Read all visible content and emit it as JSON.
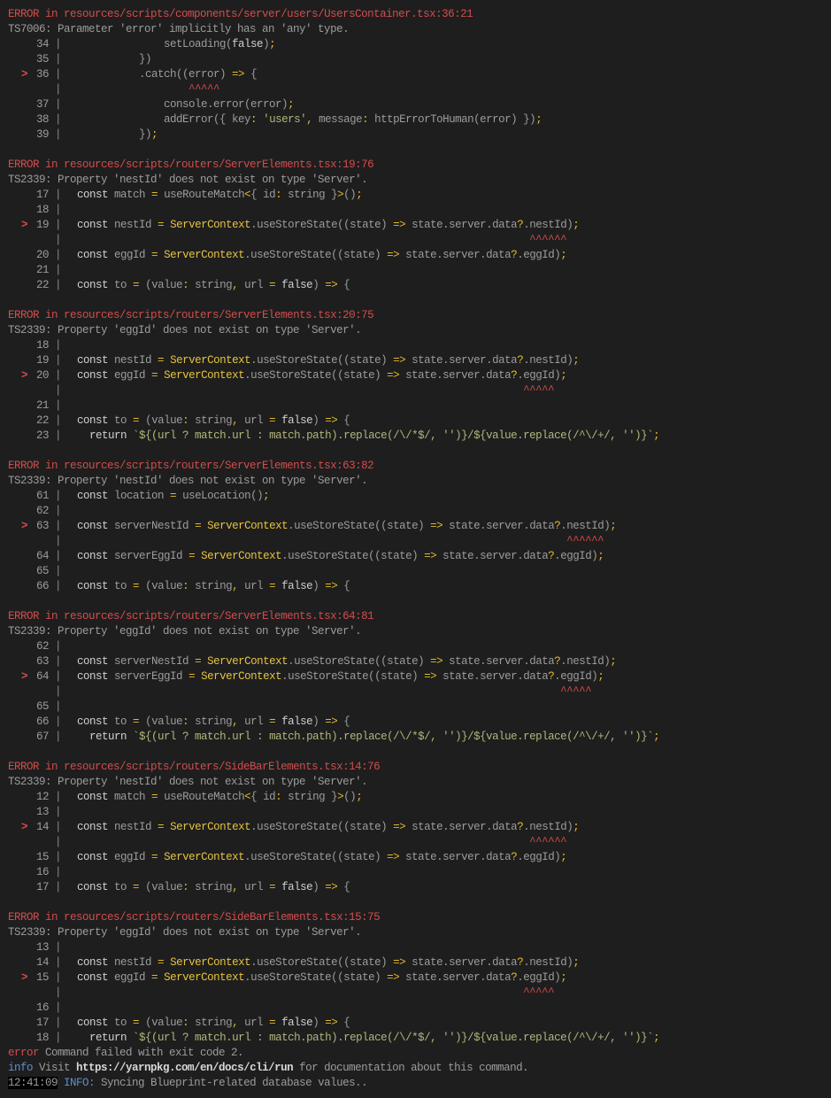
{
  "blocks": [
    {
      "label": "ERROR",
      "path": "in resources/scripts/components/server/users/UsersContainer.tsx:36:21",
      "message": "TS7006: Parameter 'error' implicitly has an 'any' type.",
      "lines": [
        {
          "num": "34",
          "code": "                setLoading(false);"
        },
        {
          "num": "35",
          "code": "            })"
        },
        {
          "num": "36",
          "marker": true,
          "code": "            .catch((error) => {",
          "caret_col": 21,
          "caret_len": 5
        },
        {
          "num": "37",
          "code": "                console.error(error);"
        },
        {
          "num": "38",
          "code": "                addError({ key: 'users', message: httpErrorToHuman(error) });"
        },
        {
          "num": "39",
          "code": "            });"
        }
      ]
    },
    {
      "label": "ERROR",
      "path": "in resources/scripts/routers/ServerElements.tsx:19:76",
      "message": "TS2339: Property 'nestId' does not exist on type 'Server'.",
      "lines": [
        {
          "num": "17",
          "code": "  const match = useRouteMatch<{ id: string }>();"
        },
        {
          "num": "18",
          "code": ""
        },
        {
          "num": "19",
          "marker": true,
          "code": "  const nestId = ServerContext.useStoreState((state) => state.server.data?.nestId);",
          "caret_col": 76,
          "caret_len": 6
        },
        {
          "num": "20",
          "code": "  const eggId = ServerContext.useStoreState((state) => state.server.data?.eggId);"
        },
        {
          "num": "21",
          "code": ""
        },
        {
          "num": "22",
          "code": "  const to = (value: string, url = false) => {"
        }
      ]
    },
    {
      "label": "ERROR",
      "path": "in resources/scripts/routers/ServerElements.tsx:20:75",
      "message": "TS2339: Property 'eggId' does not exist on type 'Server'.",
      "lines": [
        {
          "num": "18",
          "code": ""
        },
        {
          "num": "19",
          "code": "  const nestId = ServerContext.useStoreState((state) => state.server.data?.nestId);"
        },
        {
          "num": "20",
          "marker": true,
          "code": "  const eggId = ServerContext.useStoreState((state) => state.server.data?.eggId);",
          "caret_col": 75,
          "caret_len": 5
        },
        {
          "num": "21",
          "code": ""
        },
        {
          "num": "22",
          "code": "  const to = (value: string, url = false) => {"
        },
        {
          "num": "23",
          "code": "    return `${(url ? match.url : match.path).replace(/\\/*$/, '')}/${value.replace(/^\\/+/, '')}`;"
        }
      ]
    },
    {
      "label": "ERROR",
      "path": "in resources/scripts/routers/ServerElements.tsx:63:82",
      "message": "TS2339: Property 'nestId' does not exist on type 'Server'.",
      "lines": [
        {
          "num": "61",
          "code": "  const location = useLocation();"
        },
        {
          "num": "62",
          "code": ""
        },
        {
          "num": "63",
          "marker": true,
          "code": "  const serverNestId = ServerContext.useStoreState((state) => state.server.data?.nestId);",
          "caret_col": 82,
          "caret_len": 6
        },
        {
          "num": "64",
          "code": "  const serverEggId = ServerContext.useStoreState((state) => state.server.data?.eggId);"
        },
        {
          "num": "65",
          "code": ""
        },
        {
          "num": "66",
          "code": "  const to = (value: string, url = false) => {"
        }
      ]
    },
    {
      "label": "ERROR",
      "path": "in resources/scripts/routers/ServerElements.tsx:64:81",
      "message": "TS2339: Property 'eggId' does not exist on type 'Server'.",
      "lines": [
        {
          "num": "62",
          "code": ""
        },
        {
          "num": "63",
          "code": "  const serverNestId = ServerContext.useStoreState((state) => state.server.data?.nestId);"
        },
        {
          "num": "64",
          "marker": true,
          "code": "  const serverEggId = ServerContext.useStoreState((state) => state.server.data?.eggId);",
          "caret_col": 81,
          "caret_len": 5
        },
        {
          "num": "65",
          "code": ""
        },
        {
          "num": "66",
          "code": "  const to = (value: string, url = false) => {"
        },
        {
          "num": "67",
          "code": "    return `${(url ? match.url : match.path).replace(/\\/*$/, '')}/${value.replace(/^\\/+/, '')}`;"
        }
      ]
    },
    {
      "label": "ERROR",
      "path": "in resources/scripts/routers/SideBarElements.tsx:14:76",
      "message": "TS2339: Property 'nestId' does not exist on type 'Server'.",
      "lines": [
        {
          "num": "12",
          "code": "  const match = useRouteMatch<{ id: string }>();"
        },
        {
          "num": "13",
          "code": ""
        },
        {
          "num": "14",
          "marker": true,
          "code": "  const nestId = ServerContext.useStoreState((state) => state.server.data?.nestId);",
          "caret_col": 76,
          "caret_len": 6
        },
        {
          "num": "15",
          "code": "  const eggId = ServerContext.useStoreState((state) => state.server.data?.eggId);"
        },
        {
          "num": "16",
          "code": ""
        },
        {
          "num": "17",
          "code": "  const to = (value: string, url = false) => {"
        }
      ]
    },
    {
      "label": "ERROR",
      "path": "in resources/scripts/routers/SideBarElements.tsx:15:75",
      "message": "TS2339: Property 'eggId' does not exist on type 'Server'.",
      "lines": [
        {
          "num": "13",
          "code": ""
        },
        {
          "num": "14",
          "code": "  const nestId = ServerContext.useStoreState((state) => state.server.data?.nestId);"
        },
        {
          "num": "15",
          "marker": true,
          "code": "  const eggId = ServerContext.useStoreState((state) => state.server.data?.eggId);",
          "caret_col": 75,
          "caret_len": 5
        },
        {
          "num": "16",
          "code": ""
        },
        {
          "num": "17",
          "code": "  const to = (value: string, url = false) => {"
        },
        {
          "num": "18",
          "code": "    return `${(url ? match.url : match.path).replace(/\\/*$/, '')}/${value.replace(/^\\/+/, '')}`;"
        }
      ]
    }
  ],
  "footer": {
    "error_label": "error",
    "error_text": " Command failed with exit code 2.",
    "info_label": "info",
    "info_pre": " Visit ",
    "info_url": "https://yarnpkg.com/en/docs/cli/run",
    "info_post": " for documentation about this command.",
    "timestamp": "12:41:09",
    "log_level": "INFO:",
    "log_text": " Syncing Blueprint-related database values.."
  },
  "gutter": {
    "marker": ">",
    "bar": "|",
    "caret_char": "^"
  },
  "colors": {
    "background": "#1e1e1e",
    "error": "#d44c4c",
    "keyword_yellow": "#e3b92c",
    "info": "#5f8fc9"
  }
}
